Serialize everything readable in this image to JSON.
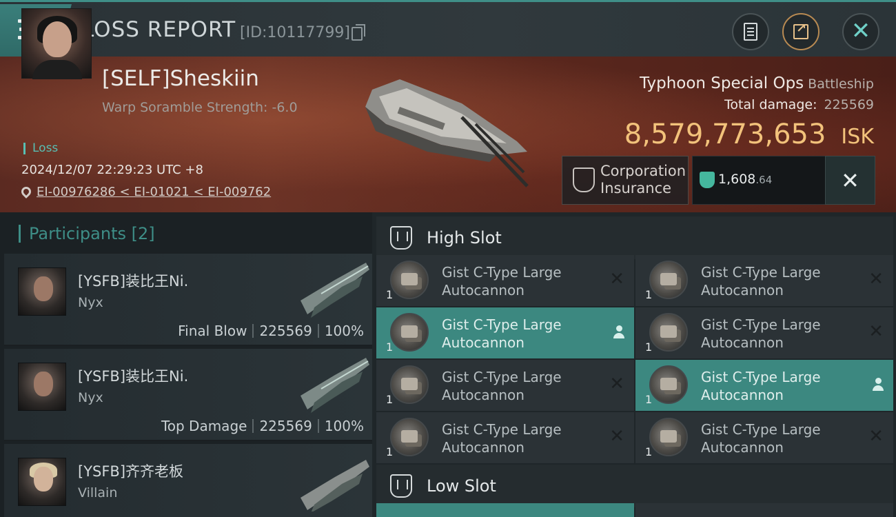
{
  "header": {
    "title": "LOSS REPORT",
    "report_id": "[ID:10117799]"
  },
  "victim": {
    "name": "[SELF]Sheskiin",
    "sub": "Warp Soramble Strength: -6.0",
    "loss_label": "Loss",
    "datetime": "2024/12/07 22:29:23 UTC +8",
    "location": "EI-00976286 < EI-01021 < EI-009762",
    "ship_name": "Typhoon Special Ops",
    "ship_class": "Battleship",
    "total_damage_label": "Total damage:",
    "total_damage": "225569",
    "isk_value": "8,579,773,653",
    "isk_unit": "ISK",
    "insurance_label": "Corporation Insurance",
    "insurance_value": "1,608",
    "insurance_decimal": ".64"
  },
  "participants": {
    "label": "Participants",
    "count": "[2]",
    "items": [
      {
        "name": "[YSFB]装比王Ni.",
        "ship": "Nyx",
        "role": "Final Blow",
        "damage": "225569",
        "percent": "100%"
      },
      {
        "name": "[YSFB]装比王Ni.",
        "ship": "Nyx",
        "role": "Top Damage",
        "damage": "225569",
        "percent": "100%"
      },
      {
        "name": "[YSFB]齐齐老板",
        "ship": "Villain"
      }
    ]
  },
  "slots": {
    "high_label": "High Slot",
    "low_label": "Low Slot",
    "modules": [
      {
        "line1": "Gist C-Type Large",
        "line2": "Autocannon",
        "qty": "1",
        "status": "destroyed"
      },
      {
        "line1": "Gist C-Type Large",
        "line2": "Autocannon",
        "qty": "1",
        "status": "destroyed"
      },
      {
        "line1": "Gist C-Type Large",
        "line2": "Autocannon",
        "qty": "1",
        "status": "dropped"
      },
      {
        "line1": "Gist C-Type Large",
        "line2": "Autocannon",
        "qty": "1",
        "status": "destroyed"
      },
      {
        "line1": "Gist C-Type Large",
        "line2": "Autocannon",
        "qty": "1",
        "status": "destroyed"
      },
      {
        "line1": "Gist C-Type Large",
        "line2": "Autocannon",
        "qty": "1",
        "status": "dropped"
      },
      {
        "line1": "Gist C-Type Large",
        "line2": "Autocannon",
        "qty": "1",
        "status": "destroyed"
      },
      {
        "line1": "Gist C-Type Large",
        "line2": "Autocannon",
        "qty": "1",
        "status": "destroyed"
      }
    ]
  },
  "colors": {
    "accent": "#3c8880",
    "isk": "#f2c27b",
    "loss_tag": "#58bfb3"
  }
}
